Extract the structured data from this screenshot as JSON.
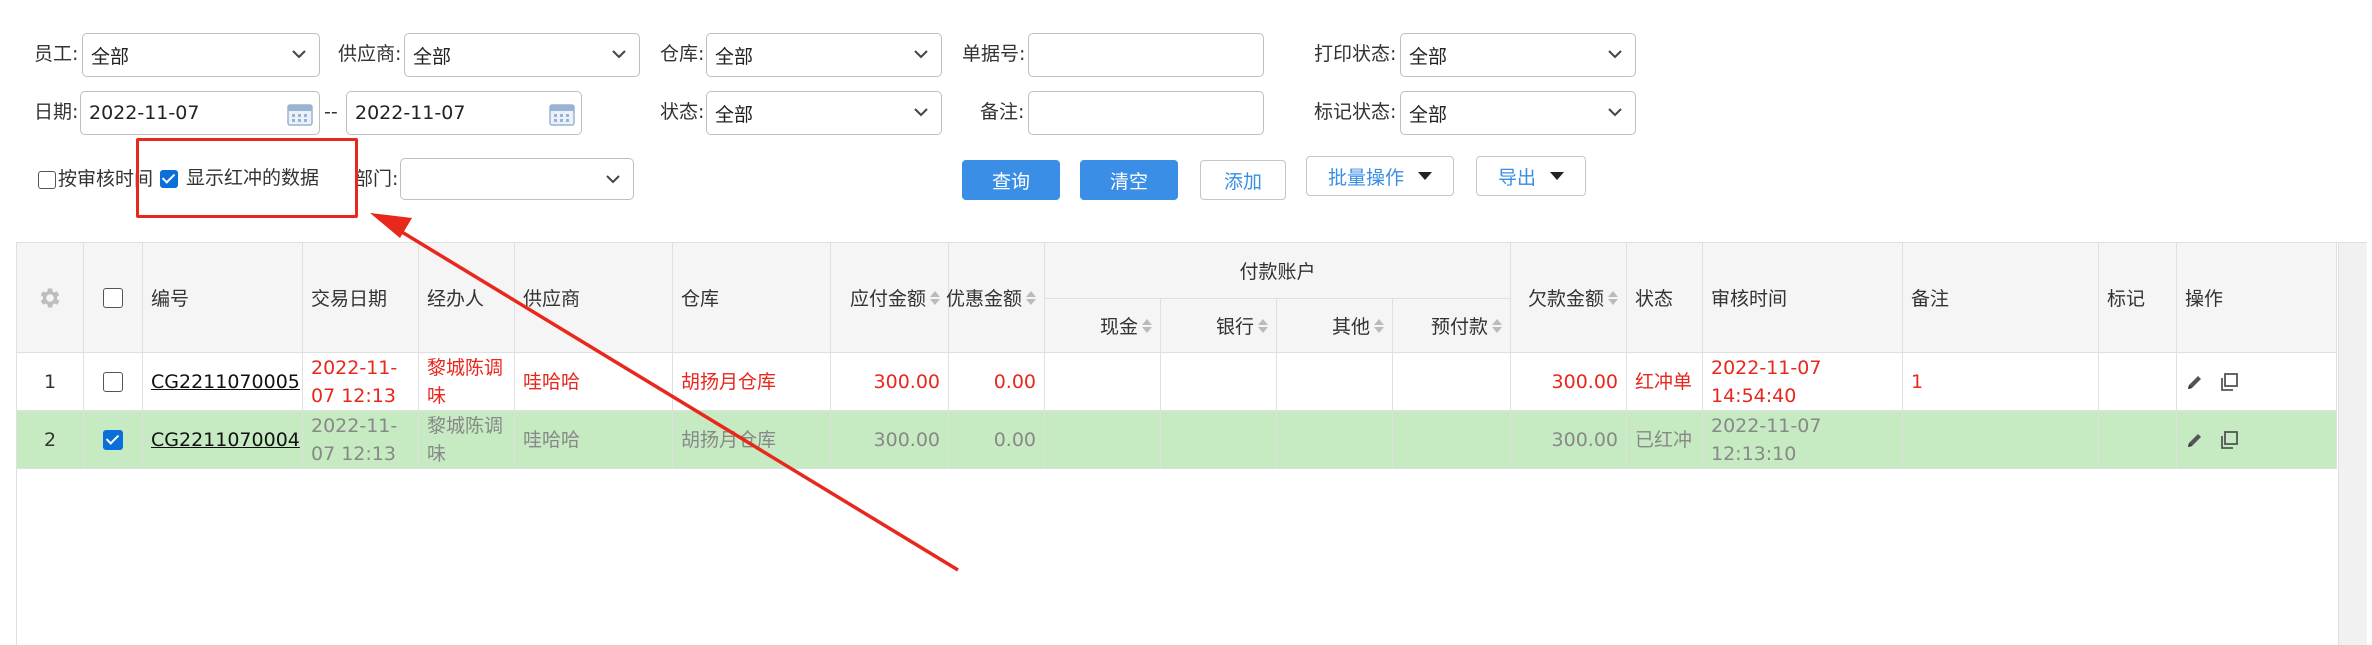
{
  "filters": {
    "employee_label": "员工:",
    "employee_value": "全部",
    "supplier_label": "供应商:",
    "supplier_value": "全部",
    "warehouse_label": "仓库:",
    "warehouse_value": "全部",
    "doc_no_label": "单据号:",
    "doc_no_value": "",
    "print_status_label": "打印状态:",
    "print_status_value": "全部",
    "date_label": "日期:",
    "date_from": "2022-11-07",
    "date_sep": "--",
    "date_to": "2022-11-07",
    "status_label": "状态:",
    "status_value": "全部",
    "remark_label": "备注:",
    "remark_value": "",
    "mark_status_label": "标记状态:",
    "mark_status_value": "全部",
    "by_audit_time_label": "按审核时间",
    "by_audit_time_checked": false,
    "show_red_label": "显示红冲的数据",
    "show_red_checked": true,
    "dept_label": "部门:",
    "dept_value": ""
  },
  "actions": {
    "query": "查询",
    "clear": "清空",
    "add": "添加",
    "batch": "批量操作",
    "export": "导出"
  },
  "table": {
    "headers": {
      "code": "编号",
      "trade_date": "交易日期",
      "handler": "经办人",
      "supplier": "供应商",
      "warehouse": "仓库",
      "payable": "应付金额",
      "discount": "优惠金额",
      "pay_account": "付款账户",
      "cash": "现金",
      "bank": "银行",
      "other": "其他",
      "prepaid": "预付款",
      "owed": "欠款金额",
      "status": "状态",
      "audit_time": "审核时间",
      "remark": "备注",
      "mark": "标记",
      "ops": "操作"
    },
    "rows": [
      {
        "index": "1",
        "checked": false,
        "code": "CG2211070005",
        "trade_date": "2022-11-07 12:13",
        "handler": "黎城陈调味",
        "supplier": "哇哈哈",
        "warehouse": "胡扬月仓库",
        "payable": "300.00",
        "discount": "0.00",
        "cash": "",
        "bank": "",
        "other": "",
        "prepaid": "",
        "owed": "300.00",
        "status": "红冲单",
        "audit_time": "2022-11-07 14:54:40",
        "remark": "1",
        "mark": ""
      },
      {
        "index": "2",
        "checked": true,
        "code": "CG2211070004",
        "trade_date": "2022-11-07 12:13",
        "handler": "黎城陈调味",
        "supplier": "哇哈哈",
        "warehouse": "胡扬月仓库",
        "payable": "300.00",
        "discount": "0.00",
        "cash": "",
        "bank": "",
        "other": "",
        "prepaid": "",
        "owed": "300.00",
        "status": "已红冲",
        "audit_time": "2022-11-07 12:13:10",
        "remark": "",
        "mark": ""
      }
    ]
  },
  "colors": {
    "primary": "#3a8ee6",
    "annotation_red": "#e8271d",
    "selected_row": "#c6ebc3",
    "red_text": "#e8271d"
  },
  "icons": {
    "settings": "gear-icon",
    "edit": "pencil-icon",
    "copy": "copy-icon",
    "calendar": "calendar-icon",
    "dropdown": "chevron-down-icon"
  }
}
